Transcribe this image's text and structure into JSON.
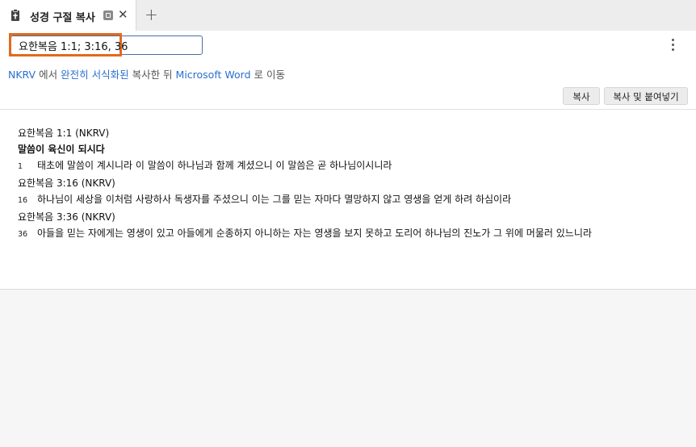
{
  "tab": {
    "title": "성경 구절 복사",
    "close": "✕",
    "add": "+"
  },
  "search": {
    "value": "요한복음 1:1; 3:16, 36"
  },
  "hint": {
    "source": "NKRV",
    "text1": "에서",
    "format": "완전히 서식화된",
    "text2": "복사한 뒤",
    "target": "Microsoft Word",
    "text3": "로 이동"
  },
  "buttons": {
    "copy": "복사",
    "copy_paste": "복사 및 붙여넣기"
  },
  "passages": [
    {
      "ref": "요한복음 1:1 (NKRV)",
      "heading": "말씀이 육신이 되시다",
      "verse_num": "1",
      "verse_text": "태초에 말씀이 계시니라 이 말씀이 하나님과 함께 계셨으니 이 말씀은 곧 하나님이시니라"
    },
    {
      "ref": "요한복음 3:16 (NKRV)",
      "verse_num": "16",
      "verse_text": "하나님이 세상을 이처럼 사랑하사 독생자를 주셨으니 이는 그를 믿는 자마다 멸망하지 않고 영생을 얻게 하려 하심이라"
    },
    {
      "ref": "요한복음 3:36 (NKRV)",
      "verse_num": "36",
      "verse_text": "아들을 믿는 자에게는 영생이 있고 아들에게 순종하지 아니하는 자는 영생을 보지 못하고 도리어 하나님의 진노가 그 위에 머물러 있느니라"
    }
  ]
}
